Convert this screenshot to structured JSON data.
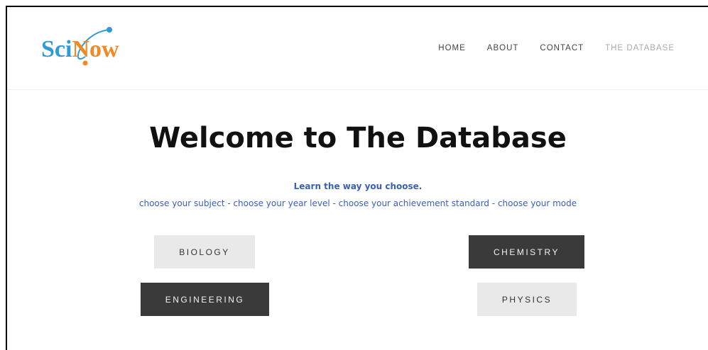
{
  "logo": {
    "part1": "Sci",
    "part2": "N",
    "part3": "ow",
    "colors": {
      "sci": "#2f9ad8",
      "now": "#f08a24",
      "orbit": "#2f9ad8",
      "dot": "#f08a24"
    }
  },
  "nav": {
    "items": [
      {
        "label": "HOME"
      },
      {
        "label": "ABOUT"
      },
      {
        "label": "CONTACT"
      },
      {
        "label": "THE DATABASE"
      }
    ]
  },
  "main": {
    "title": "Welcome to The Database",
    "tagline": "Learn the way you choose.",
    "subline": "choose your subject - choose your year level - choose your achievement standard - choose your mode"
  },
  "subjects": {
    "biology": "BIOLOGY",
    "chemistry": "CHEMISTRY",
    "engineering": "ENGINEERING",
    "physics": "PHYSICS"
  }
}
